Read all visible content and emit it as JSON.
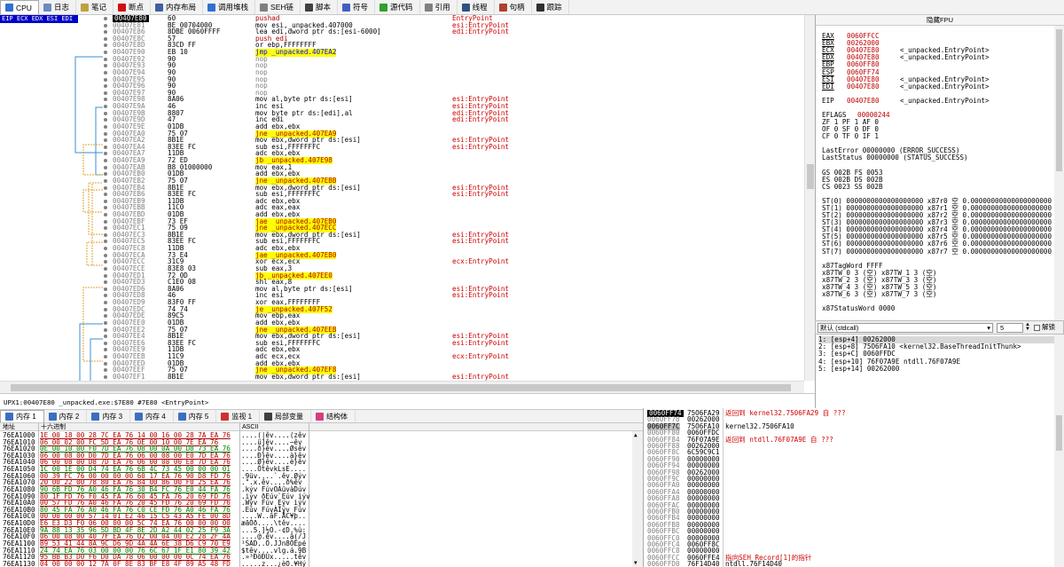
{
  "toolbar": {
    "tabs": [
      {
        "label": "CPU",
        "icon": "cpu-icon",
        "color": "#3070d0"
      },
      {
        "label": "日志",
        "icon": "log-icon",
        "color": "#6a8ac0"
      },
      {
        "label": "笔记",
        "icon": "notes-icon",
        "color": "#c0a040"
      },
      {
        "label": "断点",
        "icon": "breakpoint-icon",
        "color": "#d01010"
      },
      {
        "label": "内存布局",
        "icon": "memory-map-icon",
        "color": "#4060a0"
      },
      {
        "label": "调用堆栈",
        "icon": "call-stack-icon",
        "color": "#3070d0"
      },
      {
        "label": "SEH链",
        "icon": "seh-icon",
        "color": "#808080"
      },
      {
        "label": "脚本",
        "icon": "script-icon",
        "color": "#404040"
      },
      {
        "label": "符号",
        "icon": "symbols-icon",
        "color": "#4060c0"
      },
      {
        "label": "源代码",
        "icon": "source-icon",
        "color": "#30a030"
      },
      {
        "label": "引用",
        "icon": "references-icon",
        "color": "#808080"
      },
      {
        "label": "线程",
        "icon": "threads-icon",
        "color": "#305080"
      },
      {
        "label": "句柄",
        "icon": "handles-icon",
        "color": "#b04030"
      },
      {
        "label": "跟踪",
        "icon": "trace-icon",
        "color": "#303030"
      }
    ]
  },
  "disasm": {
    "reg_indicator": "EIP ECX EDX ESI EDI",
    "rows": [
      {
        "addr": "00407E80",
        "hex": "60",
        "asm": "pushad",
        "asm_style": "red",
        "cmt": "EntryPoint",
        "current": true
      },
      {
        "addr": "00407E81",
        "hex": "BE 00704000",
        "asm": "mov esi,_unpacked.407000",
        "asm_style": "",
        "cmt": "esi:EntryPoint"
      },
      {
        "addr": "00407E86",
        "hex": "8DBE 0060FFFF",
        "asm": "lea edi,dword ptr ds:[esi-6000]",
        "asm_style": "",
        "cmt": "edi:EntryPoint"
      },
      {
        "addr": "00407E8C",
        "hex": "57",
        "asm": "push edi",
        "asm_style": "red",
        "cmt": ""
      },
      {
        "addr": "00407E8D",
        "hex": "83CD FF",
        "asm": "or ebp,FFFFFFFF",
        "asm_style": "",
        "cmt": ""
      },
      {
        "addr": "00407E90",
        "hex": "EB 10",
        "asm": "jmp _unpacked.407EA2",
        "asm_style": "jmp",
        "cmt": ""
      },
      {
        "addr": "00407E92",
        "hex": "90",
        "asm": "nop",
        "asm_style": "gray",
        "cmt": ""
      },
      {
        "addr": "00407E93",
        "hex": "90",
        "asm": "nop",
        "asm_style": "gray",
        "cmt": ""
      },
      {
        "addr": "00407E94",
        "hex": "90",
        "asm": "nop",
        "asm_style": "gray",
        "cmt": ""
      },
      {
        "addr": "00407E95",
        "hex": "90",
        "asm": "nop",
        "asm_style": "gray",
        "cmt": ""
      },
      {
        "addr": "00407E96",
        "hex": "90",
        "asm": "nop",
        "asm_style": "gray",
        "cmt": ""
      },
      {
        "addr": "00407E97",
        "hex": "90",
        "asm": "nop",
        "asm_style": "gray",
        "cmt": ""
      },
      {
        "addr": "00407E98",
        "hex": "8A06",
        "asm": "mov al,byte ptr ds:[esi]",
        "asm_style": "",
        "cmt": "esi:EntryPoint"
      },
      {
        "addr": "00407E9A",
        "hex": "46",
        "asm": "inc esi",
        "asm_style": "",
        "cmt": "esi:EntryPoint"
      },
      {
        "addr": "00407E9B",
        "hex": "8807",
        "asm": "mov byte ptr ds:[edi],al",
        "asm_style": "",
        "cmt": "edi:EntryPoint"
      },
      {
        "addr": "00407E9D",
        "hex": "47",
        "asm": "inc edi",
        "asm_style": "",
        "cmt": "edi:EntryPoint"
      },
      {
        "addr": "00407E9E",
        "hex": "01DB",
        "asm": "add ebx,ebx",
        "asm_style": "",
        "cmt": ""
      },
      {
        "addr": "00407EA0",
        "hex": "75 07",
        "asm": "jne _unpacked.407EA9",
        "asm_style": "jcc",
        "cmt": ""
      },
      {
        "addr": "00407EA2",
        "hex": "8B1E",
        "asm": "mov ebx,dword ptr ds:[esi]",
        "asm_style": "",
        "cmt": "esi:EntryPoint"
      },
      {
        "addr": "00407EA4",
        "hex": "83EE FC",
        "asm": "sub esi,FFFFFFFC",
        "asm_style": "",
        "cmt": "esi:EntryPoint"
      },
      {
        "addr": "00407EA7",
        "hex": "11DB",
        "asm": "adc ebx,ebx",
        "asm_style": "",
        "cmt": ""
      },
      {
        "addr": "00407EA9",
        "hex": "72 ED",
        "asm": "jb _unpacked.407E98",
        "asm_style": "jcc",
        "cmt": ""
      },
      {
        "addr": "00407EAB",
        "hex": "B8 01000000",
        "asm": "mov eax,1",
        "asm_style": "",
        "cmt": ""
      },
      {
        "addr": "00407EB0",
        "hex": "01DB",
        "asm": "add ebx,ebx",
        "asm_style": "",
        "cmt": ""
      },
      {
        "addr": "00407EB2",
        "hex": "75 07",
        "asm": "jne _unpacked.407EBB",
        "asm_style": "jcc",
        "cmt": ""
      },
      {
        "addr": "00407EB4",
        "hex": "8B1E",
        "asm": "mov ebx,dword ptr ds:[esi]",
        "asm_style": "",
        "cmt": "esi:EntryPoint"
      },
      {
        "addr": "00407EB6",
        "hex": "83EE FC",
        "asm": "sub esi,FFFFFFFC",
        "asm_style": "",
        "cmt": "esi:EntryPoint"
      },
      {
        "addr": "00407EB9",
        "hex": "11DB",
        "asm": "adc ebx,ebx",
        "asm_style": "",
        "cmt": ""
      },
      {
        "addr": "00407EBB",
        "hex": "11C0",
        "asm": "adc eax,eax",
        "asm_style": "",
        "cmt": ""
      },
      {
        "addr": "00407EBD",
        "hex": "01DB",
        "asm": "add ebx,ebx",
        "asm_style": "",
        "cmt": ""
      },
      {
        "addr": "00407EBF",
        "hex": "73 EF",
        "asm": "jae _unpacked.407EB0",
        "asm_style": "jcc",
        "cmt": ""
      },
      {
        "addr": "00407EC1",
        "hex": "75 09",
        "asm": "jne _unpacked.407ECC",
        "asm_style": "jcc",
        "cmt": ""
      },
      {
        "addr": "00407EC3",
        "hex": "8B1E",
        "asm": "mov ebx,dword ptr ds:[esi]",
        "asm_style": "",
        "cmt": "esi:EntryPoint"
      },
      {
        "addr": "00407EC5",
        "hex": "83EE FC",
        "asm": "sub esi,FFFFFFFC",
        "asm_style": "",
        "cmt": "esi:EntryPoint"
      },
      {
        "addr": "00407EC8",
        "hex": "11DB",
        "asm": "adc ebx,ebx",
        "asm_style": "",
        "cmt": ""
      },
      {
        "addr": "00407ECA",
        "hex": "73 E4",
        "asm": "jae _unpacked.407EB0",
        "asm_style": "jcc",
        "cmt": ""
      },
      {
        "addr": "00407ECC",
        "hex": "31C9",
        "asm": "xor ecx,ecx",
        "asm_style": "",
        "cmt": "ecx:EntryPoint"
      },
      {
        "addr": "00407ECE",
        "hex": "83E8 03",
        "asm": "sub eax,3",
        "asm_style": "",
        "cmt": ""
      },
      {
        "addr": "00407ED1",
        "hex": "72 0D",
        "asm": "jb _unpacked.407EE0",
        "asm_style": "jcc",
        "cmt": ""
      },
      {
        "addr": "00407ED3",
        "hex": "C1E0 08",
        "asm": "shl eax,8",
        "asm_style": "",
        "cmt": ""
      },
      {
        "addr": "00407ED6",
        "hex": "8A06",
        "asm": "mov al,byte ptr ds:[esi]",
        "asm_style": "",
        "cmt": "esi:EntryPoint"
      },
      {
        "addr": "00407ED8",
        "hex": "46",
        "asm": "inc esi",
        "asm_style": "",
        "cmt": "esi:EntryPoint"
      },
      {
        "addr": "00407ED9",
        "hex": "83F0 FF",
        "asm": "xor eax,FFFFFFFF",
        "asm_style": "",
        "cmt": ""
      },
      {
        "addr": "00407EDC",
        "hex": "74 74",
        "asm": "je _unpacked.407F52",
        "asm_style": "jcc",
        "cmt": ""
      },
      {
        "addr": "00407EDE",
        "hex": "89C5",
        "asm": "mov ebp,eax",
        "asm_style": "",
        "cmt": ""
      },
      {
        "addr": "00407EE0",
        "hex": "01DB",
        "asm": "add ebx,ebx",
        "asm_style": "",
        "cmt": ""
      },
      {
        "addr": "00407EE2",
        "hex": "75 07",
        "asm": "jne _unpacked.407EEB",
        "asm_style": "jcc",
        "cmt": ""
      },
      {
        "addr": "00407EE4",
        "hex": "8B1E",
        "asm": "mov ebx,dword ptr ds:[esi]",
        "asm_style": "",
        "cmt": "esi:EntryPoint"
      },
      {
        "addr": "00407EE6",
        "hex": "83EE FC",
        "asm": "sub esi,FFFFFFFC",
        "asm_style": "",
        "cmt": "esi:EntryPoint"
      },
      {
        "addr": "00407EE9",
        "hex": "11DB",
        "asm": "adc ebx,ebx",
        "asm_style": "",
        "cmt": ""
      },
      {
        "addr": "00407EEB",
        "hex": "11C9",
        "asm": "adc ecx,ecx",
        "asm_style": "",
        "cmt": "ecx:EntryPoint"
      },
      {
        "addr": "00407EED",
        "hex": "01DB",
        "asm": "add ebx,ebx",
        "asm_style": "",
        "cmt": ""
      },
      {
        "addr": "00407EEF",
        "hex": "75 07",
        "asm": "jne _unpacked.407EF8",
        "asm_style": "jcc",
        "cmt": ""
      },
      {
        "addr": "00407EF1",
        "hex": "8B1E",
        "asm": "mov ebx,dword ptr ds:[esi]",
        "asm_style": "",
        "cmt": "esi:EntryPoint"
      }
    ]
  },
  "status": {
    "text": "UPX1:00407E80 _unpacked.exe:$7E80 #7E80 <EntryPoint>"
  },
  "registers": {
    "header": "隐藏FPU",
    "gp": [
      {
        "name": "EAX",
        "value": "0060FFCC",
        "comment": ""
      },
      {
        "name": "EBX",
        "value": "00262000",
        "comment": ""
      },
      {
        "name": "ECX",
        "value": "00407E80",
        "comment": "<_unpacked.EntryPoint>"
      },
      {
        "name": "EDX",
        "value": "00407E80",
        "comment": "<_unpacked.EntryPoint>"
      },
      {
        "name": "EBP",
        "value": "0060FF80",
        "comment": ""
      },
      {
        "name": "ESP",
        "value": "0060FF74",
        "comment": ""
      },
      {
        "name": "ESI",
        "value": "00407E80",
        "comment": "<_unpacked.EntryPoint>"
      },
      {
        "name": "EDI",
        "value": "00407E80",
        "comment": "<_unpacked.EntryPoint>"
      }
    ],
    "eip": {
      "name": "EIP",
      "value": "00407E80",
      "comment": "<_unpacked.EntryPoint>"
    },
    "eflags": {
      "name": "EFLAGS",
      "value": "00000244"
    },
    "flags_lines": [
      "ZF 1  PF 1  AF 0",
      "OF 0  SF 0  DF 0",
      "CF 0  TF 0  IF 1"
    ],
    "last_lines": [
      "LastError  00000000 (ERROR_SUCCESS)",
      "LastStatus 00000000 (STATUS_SUCCESS)"
    ],
    "seg_lines": [
      "GS 002B  FS 0053",
      "ES 002B  DS 002B",
      "CS 0023  SS 002B"
    ],
    "st_lines": [
      "ST(0) 0000000000000000000 x87r0 空 0.00000000000000000000",
      "ST(1) 0000000000000000000 x87r1 空 0.00000000000000000000",
      "ST(2) 0000000000000000000 x87r2 空 0.00000000000000000000",
      "ST(3) 0000000000000000000 x87r3 空 0.00000000000000000000",
      "ST(4) 0000000000000000000 x87r4 空 0.00000000000000000000",
      "ST(5) 0000000000000000000 x87r5 空 0.00000000000000000000",
      "ST(6) 0000000000000000000 x87r6 空 0.00000000000000000000",
      "ST(7) 0000000000000000000 x87r7 空 0.00000000000000000000"
    ],
    "tag_lines": [
      "x87TagWord FFFF",
      "x87TW_0 3 (空)       x87TW_1 3 (空)",
      "x87TW_2 3 (空)       x87TW_3 3 (空)",
      "x87TW_4 3 (空)       x87TW_5 3 (空)",
      "x87TW_6 3 (空)       x87TW_7 3 (空)"
    ],
    "status_word": "x87StatusWord 0000"
  },
  "callconv": {
    "selected": "默认 (stdcall)",
    "count": "5",
    "lock_label": "解锁"
  },
  "args": [
    "1: [esp+4]  00262000",
    "2: [esp+8]  75O6FA10 <kernel32.BaseThreadInitThunk>",
    "3: [esp+C]  0060FFDC",
    "4: [esp+10] 76F07A9E ntdll.76F07A9E",
    "5: [esp+14] 00262000"
  ],
  "memory_tabs": [
    {
      "label": "内存 1",
      "icon": "memory-icon",
      "active": true
    },
    {
      "label": "内存 2",
      "icon": "memory-icon"
    },
    {
      "label": "内存 3",
      "icon": "memory-icon"
    },
    {
      "label": "内存 4",
      "icon": "memory-icon"
    },
    {
      "label": "内存 5",
      "icon": "memory-icon"
    },
    {
      "label": "监视 1",
      "icon": "watch-icon"
    },
    {
      "label": "局部变量",
      "icon": "locals-icon"
    },
    {
      "label": "结构体",
      "icon": "struct-icon"
    }
  ],
  "dump": {
    "columns": [
      "地址",
      "十六进制",
      "ASCII"
    ],
    "rows": [
      {
        "addr": "76EA1000",
        "hex": "1E 00 18 00 28 7C EA 76 14 00 16 00 28 7A EA 76",
        "ascii": "....(|êv....(zêv"
      },
      {
        "addr": "76EA1010",
        "hex": "06 00 02 00 FC 5D EA 76 0E 00 10 00 7E EA 76",
        "ascii": "....ü]êv....~êv"
      },
      {
        "addr": "76EA1020",
        "hex": "0E 00 10 00 F0 7D EA 76 08 00 0A 00 D8 73 EA 76",
        "ascii": "....ð}êv....Øsêv"
      },
      {
        "addr": "76EA1030",
        "hex": "06 00 08 00 D0 7D EA 76 06 00 08 00 E0 7D EA 76",
        "ascii": "....Ð}êv....à}êv"
      },
      {
        "addr": "76EA1040",
        "hex": "06 00 08 00 D8 7D EA 76 06 00 08 00 E8 7D EA 76",
        "ascii": "....Ø}êv....è}êv"
      },
      {
        "addr": "76EA1050",
        "hex": "1C 00 1E 00 D4 74 EA 76 6B 4C 73 45 00 00 00 01",
        "ascii": "....ÔtêvkLsE...."
      },
      {
        "addr": "76EA1060",
        "hex": "00 39 FC 76 00 00 00 00 60 17 EA 76 90 D8 FD 76",
        "ascii": ".9üv....`.êv.Øýv"
      },
      {
        "addr": "76EA1070",
        "hex": "20 00 22 00 78 80 EA 76 84 00 86 00 F0 25 EA 76",
        "ascii": " .\".x.êv....ð%êv"
      },
      {
        "addr": "76EA1080",
        "hex": "90 6B FD 76 A0 46 FA 76 30 B4 FC 76 E0 44 FA 76",
        "ascii": ".kýv FúvOÀüvàDúv"
      },
      {
        "addr": "76EA1090",
        "hex": "80 1F FD 76 F0 45 FA 76 60 45 FA 76 20 69 FD 76",
        "ascii": ".iýv ðEúv`Eúv iýv"
      },
      {
        "addr": "76EA10A0",
        "hex": "00 57 FD 76 A0 46 FA 76 20 45 FD 76 20 69 FD 76",
        "ascii": ".Wýv Fúv Eýv iýv"
      },
      {
        "addr": "76EA10B0",
        "hex": "80 45 FA 76 A0 46 FA 76 C0 CE FD 76 A0 46 FA 76",
        "ascii": ".Eúv FúvÀÎýv Fúv"
      },
      {
        "addr": "76EA10C0",
        "hex": "00 00 00 00 57 14 01 E2 46 15 C5 43 A5 FE 00 8D",
        "ascii": "....W..âF.ÅC¥þ.."
      },
      {
        "addr": "76EA10D0",
        "hex": "E6 E3 D3 F0 06 00 00 00 5C 74 EA 76 00 00 00 00",
        "ascii": "æãÓð....\\têv...."
      },
      {
        "addr": "76EA10E0",
        "hex": "9A 88 13 35 96 5D BD 4F 8E 2D A2 44 02 25 F9 3A",
        "ascii": "...5.]½O.-¢D.%ù:"
      },
      {
        "addr": "76EA10F0",
        "hex": "06 00 08 00 40 7F EA 76 02 00 04 00 E2 28 2F 4A",
        "ascii": "....@.êv....â(/J"
      },
      {
        "addr": "76EA1100",
        "hex": "B9 53 41 44 8A 9C D6 9D 4A 4A 6E 38 D6 C9 70 E9",
        "ascii": "¹SAD..Ö.JJn8ÖÉpé"
      },
      {
        "addr": "76EA1110",
        "hex": "24 74 EA 76 03 00 00 00 76 6C 67 1F E1 80 39 42",
        "ascii": "$têv....vlg.á.9B"
      },
      {
        "addr": "76EA1120",
        "hex": "95 BB B3 D0 F6 D0 DA 78 06 00 00 00 0C 74 EA 76",
        "ascii": ".»³ÐöÐÚx.....têv"
      },
      {
        "addr": "76EA1130",
        "hex": "04 00 00 00 12 7A 0F 8E 83 BF E8 4F 89 A5 48 FD",
        "ascii": ".....z...¿èO.¥Hý"
      }
    ]
  },
  "stack": [
    {
      "addr": "0060FF74",
      "val": "75O6FA29",
      "cmt": "返回到 kernel32.7506FA29 自 ???",
      "top": true
    },
    {
      "addr": "0060FF78",
      "val": "00262000",
      "cmt": ""
    },
    {
      "addr": "0060FF7C",
      "val": "75O6FA10",
      "cmt": "kernel32.7506FA10",
      "hl": true
    },
    {
      "addr": "0060FF80",
      "val": "0060FFDC",
      "cmt": ""
    },
    {
      "addr": "0060FF84",
      "val": "76F07A9E",
      "cmt": "返回到 ntdll.76F07A9E 自 ???"
    },
    {
      "addr": "0060FF88",
      "val": "00262000",
      "cmt": ""
    },
    {
      "addr": "0060FF8C",
      "val": "6C59C9C1",
      "cmt": ""
    },
    {
      "addr": "0060FF90",
      "val": "00000000",
      "cmt": ""
    },
    {
      "addr": "0060FF94",
      "val": "00000000",
      "cmt": ""
    },
    {
      "addr": "0060FF98",
      "val": "00262000",
      "cmt": ""
    },
    {
      "addr": "0060FF9C",
      "val": "00000000",
      "cmt": ""
    },
    {
      "addr": "0060FFA0",
      "val": "00000000",
      "cmt": ""
    },
    {
      "addr": "0060FFA4",
      "val": "00000000",
      "cmt": ""
    },
    {
      "addr": "0060FFA8",
      "val": "00000000",
      "cmt": ""
    },
    {
      "addr": "0060FFAC",
      "val": "00000000",
      "cmt": ""
    },
    {
      "addr": "0060FFB0",
      "val": "00000000",
      "cmt": ""
    },
    {
      "addr": "0060FFB4",
      "val": "00000000",
      "cmt": ""
    },
    {
      "addr": "0060FFB8",
      "val": "00000000",
      "cmt": ""
    },
    {
      "addr": "0060FFBC",
      "val": "00000000",
      "cmt": ""
    },
    {
      "addr": "0060FFC0",
      "val": "00000000",
      "cmt": ""
    },
    {
      "addr": "0060FFC4",
      "val": "0060FF8C",
      "cmt": ""
    },
    {
      "addr": "0060FFC8",
      "val": "00000000",
      "cmt": ""
    },
    {
      "addr": "0060FFCC",
      "val": "0060FFE4",
      "cmt": "指向SEH_Record[1]的指针"
    },
    {
      "addr": "0060FFD0",
      "val": "76F14D40",
      "cmt": "ntdll.76F14D40"
    }
  ]
}
